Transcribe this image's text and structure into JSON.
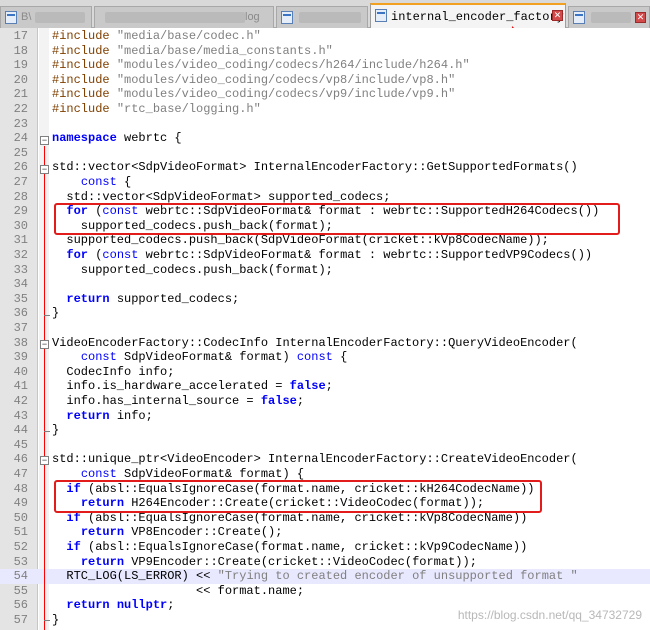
{
  "tabs": [
    {
      "label": "B\\",
      "active": false
    },
    {
      "label": "log",
      "active": false
    },
    {
      "label": "internal_encoder_factory.cc",
      "active": true
    },
    {
      "label": "",
      "active": false
    }
  ],
  "close_glyph": "✕",
  "lines": [
    {
      "n": "17",
      "tokens": [
        {
          "t": "pre",
          "v": "#include "
        },
        {
          "t": "str",
          "v": "\"media/base/codec.h\""
        }
      ]
    },
    {
      "n": "18",
      "tokens": [
        {
          "t": "pre",
          "v": "#include "
        },
        {
          "t": "str",
          "v": "\"media/base/media_constants.h\""
        }
      ]
    },
    {
      "n": "19",
      "tokens": [
        {
          "t": "pre",
          "v": "#include "
        },
        {
          "t": "str",
          "v": "\"modules/video_coding/codecs/h264/include/h264.h\""
        }
      ]
    },
    {
      "n": "20",
      "tokens": [
        {
          "t": "pre",
          "v": "#include "
        },
        {
          "t": "str",
          "v": "\"modules/video_coding/codecs/vp8/include/vp8.h\""
        }
      ]
    },
    {
      "n": "21",
      "tokens": [
        {
          "t": "pre",
          "v": "#include "
        },
        {
          "t": "str",
          "v": "\"modules/video_coding/codecs/vp9/include/vp9.h\""
        }
      ]
    },
    {
      "n": "22",
      "tokens": [
        {
          "t": "pre",
          "v": "#include "
        },
        {
          "t": "str",
          "v": "\"rtc_base/logging.h\""
        }
      ]
    },
    {
      "n": "23",
      "tokens": []
    },
    {
      "n": "24",
      "tokens": [
        {
          "t": "kw",
          "v": "namespace"
        },
        {
          "t": "p",
          "v": " webrtc {"
        }
      ]
    },
    {
      "n": "25",
      "tokens": []
    },
    {
      "n": "26",
      "tokens": [
        {
          "t": "p",
          "v": "std::vector<SdpVideoFormat> InternalEncoderFactory::GetSupportedFormats()"
        }
      ]
    },
    {
      "n": "27",
      "tokens": [
        {
          "t": "p",
          "v": "    "
        },
        {
          "t": "kw2",
          "v": "const"
        },
        {
          "t": "p",
          "v": " {"
        }
      ]
    },
    {
      "n": "28",
      "tokens": [
        {
          "t": "p",
          "v": "  std::vector<SdpVideoFormat> supported_codecs;"
        }
      ]
    },
    {
      "n": "29",
      "tokens": [
        {
          "t": "p",
          "v": "  "
        },
        {
          "t": "kw",
          "v": "for"
        },
        {
          "t": "p",
          "v": " ("
        },
        {
          "t": "kw2",
          "v": "const"
        },
        {
          "t": "p",
          "v": " webrtc::SdpVideoFormat& format : webrtc::SupportedH264Codecs())"
        }
      ]
    },
    {
      "n": "30",
      "tokens": [
        {
          "t": "p",
          "v": "    supported_codecs.push_back(format);"
        }
      ]
    },
    {
      "n": "31",
      "tokens": [
        {
          "t": "p",
          "v": "  supported_codecs.push_back(SdpVideoFormat(cricket::kVp8CodecName));"
        }
      ]
    },
    {
      "n": "32",
      "tokens": [
        {
          "t": "p",
          "v": "  "
        },
        {
          "t": "kw",
          "v": "for"
        },
        {
          "t": "p",
          "v": " ("
        },
        {
          "t": "kw2",
          "v": "const"
        },
        {
          "t": "p",
          "v": " webrtc::SdpVideoFormat& format : webrtc::SupportedVP9Codecs())"
        }
      ]
    },
    {
      "n": "33",
      "tokens": [
        {
          "t": "p",
          "v": "    supported_codecs.push_back(format);"
        }
      ]
    },
    {
      "n": "34",
      "tokens": []
    },
    {
      "n": "35",
      "tokens": [
        {
          "t": "p",
          "v": "  "
        },
        {
          "t": "kw",
          "v": "return"
        },
        {
          "t": "p",
          "v": " supported_codecs;"
        }
      ]
    },
    {
      "n": "36",
      "tokens": [
        {
          "t": "p",
          "v": "}"
        }
      ]
    },
    {
      "n": "37",
      "tokens": []
    },
    {
      "n": "38",
      "tokens": [
        {
          "t": "p",
          "v": "VideoEncoderFactory::CodecInfo InternalEncoderFactory::QueryVideoEncoder("
        }
      ]
    },
    {
      "n": "39",
      "tokens": [
        {
          "t": "p",
          "v": "    "
        },
        {
          "t": "kw2",
          "v": "const"
        },
        {
          "t": "p",
          "v": " SdpVideoFormat& format) "
        },
        {
          "t": "kw2",
          "v": "const"
        },
        {
          "t": "p",
          "v": " {"
        }
      ]
    },
    {
      "n": "40",
      "tokens": [
        {
          "t": "p",
          "v": "  CodecInfo info;"
        }
      ]
    },
    {
      "n": "41",
      "tokens": [
        {
          "t": "p",
          "v": "  info.is_hardware_accelerated = "
        },
        {
          "t": "kw",
          "v": "false"
        },
        {
          "t": "p",
          "v": ";"
        }
      ]
    },
    {
      "n": "42",
      "tokens": [
        {
          "t": "p",
          "v": "  info.has_internal_source = "
        },
        {
          "t": "kw",
          "v": "false"
        },
        {
          "t": "p",
          "v": ";"
        }
      ]
    },
    {
      "n": "43",
      "tokens": [
        {
          "t": "p",
          "v": "  "
        },
        {
          "t": "kw",
          "v": "return"
        },
        {
          "t": "p",
          "v": " info;"
        }
      ]
    },
    {
      "n": "44",
      "tokens": [
        {
          "t": "p",
          "v": "}"
        }
      ]
    },
    {
      "n": "45",
      "tokens": []
    },
    {
      "n": "46",
      "tokens": [
        {
          "t": "p",
          "v": "std::unique_ptr<VideoEncoder> InternalEncoderFactory::CreateVideoEncoder("
        }
      ]
    },
    {
      "n": "47",
      "tokens": [
        {
          "t": "p",
          "v": "    "
        },
        {
          "t": "kw2",
          "v": "const"
        },
        {
          "t": "p",
          "v": " SdpVideoFormat& format) {"
        }
      ]
    },
    {
      "n": "48",
      "tokens": [
        {
          "t": "p",
          "v": "  "
        },
        {
          "t": "kw",
          "v": "if"
        },
        {
          "t": "p",
          "v": " (absl::EqualsIgnoreCase(format.name, cricket::kH264CodecName))"
        }
      ]
    },
    {
      "n": "49",
      "tokens": [
        {
          "t": "p",
          "v": "    "
        },
        {
          "t": "kw",
          "v": "return"
        },
        {
          "t": "p",
          "v": " H264Encoder::Create(cricket::VideoCodec(format));"
        }
      ]
    },
    {
      "n": "50",
      "tokens": [
        {
          "t": "p",
          "v": "  "
        },
        {
          "t": "kw",
          "v": "if"
        },
        {
          "t": "p",
          "v": " (absl::EqualsIgnoreCase(format.name, cricket::kVp8CodecName))"
        }
      ]
    },
    {
      "n": "51",
      "tokens": [
        {
          "t": "p",
          "v": "    "
        },
        {
          "t": "kw",
          "v": "return"
        },
        {
          "t": "p",
          "v": " VP8Encoder::Create();"
        }
      ]
    },
    {
      "n": "52",
      "tokens": [
        {
          "t": "p",
          "v": "  "
        },
        {
          "t": "kw",
          "v": "if"
        },
        {
          "t": "p",
          "v": " (absl::EqualsIgnoreCase(format.name, cricket::kVp9CodecName))"
        }
      ]
    },
    {
      "n": "53",
      "tokens": [
        {
          "t": "p",
          "v": "    "
        },
        {
          "t": "kw",
          "v": "return"
        },
        {
          "t": "p",
          "v": " VP9Encoder::Create(cricket::VideoCodec(format));"
        }
      ]
    },
    {
      "n": "54",
      "tokens": [
        {
          "t": "p",
          "v": "  RTC_LOG(LS_ERROR) << "
        },
        {
          "t": "str",
          "v": "\"Trying to created encoder of unsupported format \""
        }
      ]
    },
    {
      "n": "55",
      "tokens": [
        {
          "t": "p",
          "v": "                    << format.name;"
        }
      ]
    },
    {
      "n": "56",
      "tokens": [
        {
          "t": "p",
          "v": "  "
        },
        {
          "t": "kw",
          "v": "return"
        },
        {
          "t": "p",
          "v": " "
        },
        {
          "t": "kw",
          "v": "nullptr"
        },
        {
          "t": "p",
          "v": ";"
        }
      ]
    },
    {
      "n": "57",
      "tokens": [
        {
          "t": "p",
          "v": "}"
        }
      ]
    }
  ],
  "highlighted_line": "54",
  "watermark": "https://blog.csdn.net/qq_34732729",
  "colors": {
    "callout": "#e21b1b",
    "keyword": "#0000ff",
    "string": "#808080",
    "preprocessor": "#804000"
  }
}
